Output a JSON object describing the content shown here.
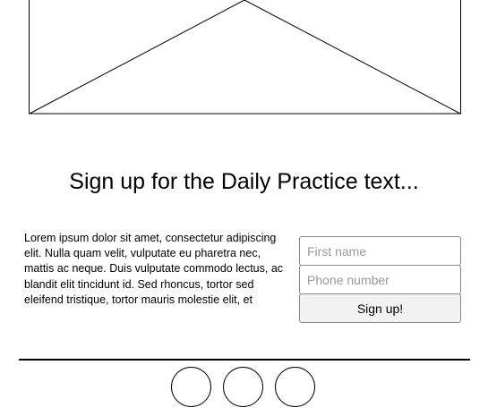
{
  "heading": "Sign up for the Daily Practice text...",
  "body_text": "Lorem ipsum dolor sit amet, consectetur adipiscing elit. Nulla quam velit, vulputate eu pharetra nec, mattis ac neque. Duis vulputate commodo lectus, ac blandit elit tincidunt id. Sed rhoncus, tortor sed eleifend tristique, tortor mauris molestie elit, et",
  "form": {
    "first_name_placeholder": "First name",
    "phone_placeholder": "Phone number",
    "submit_label": "Sign up!"
  },
  "footer": {
    "social_icons": [
      "circle-icon",
      "circle-icon",
      "circle-icon"
    ]
  }
}
